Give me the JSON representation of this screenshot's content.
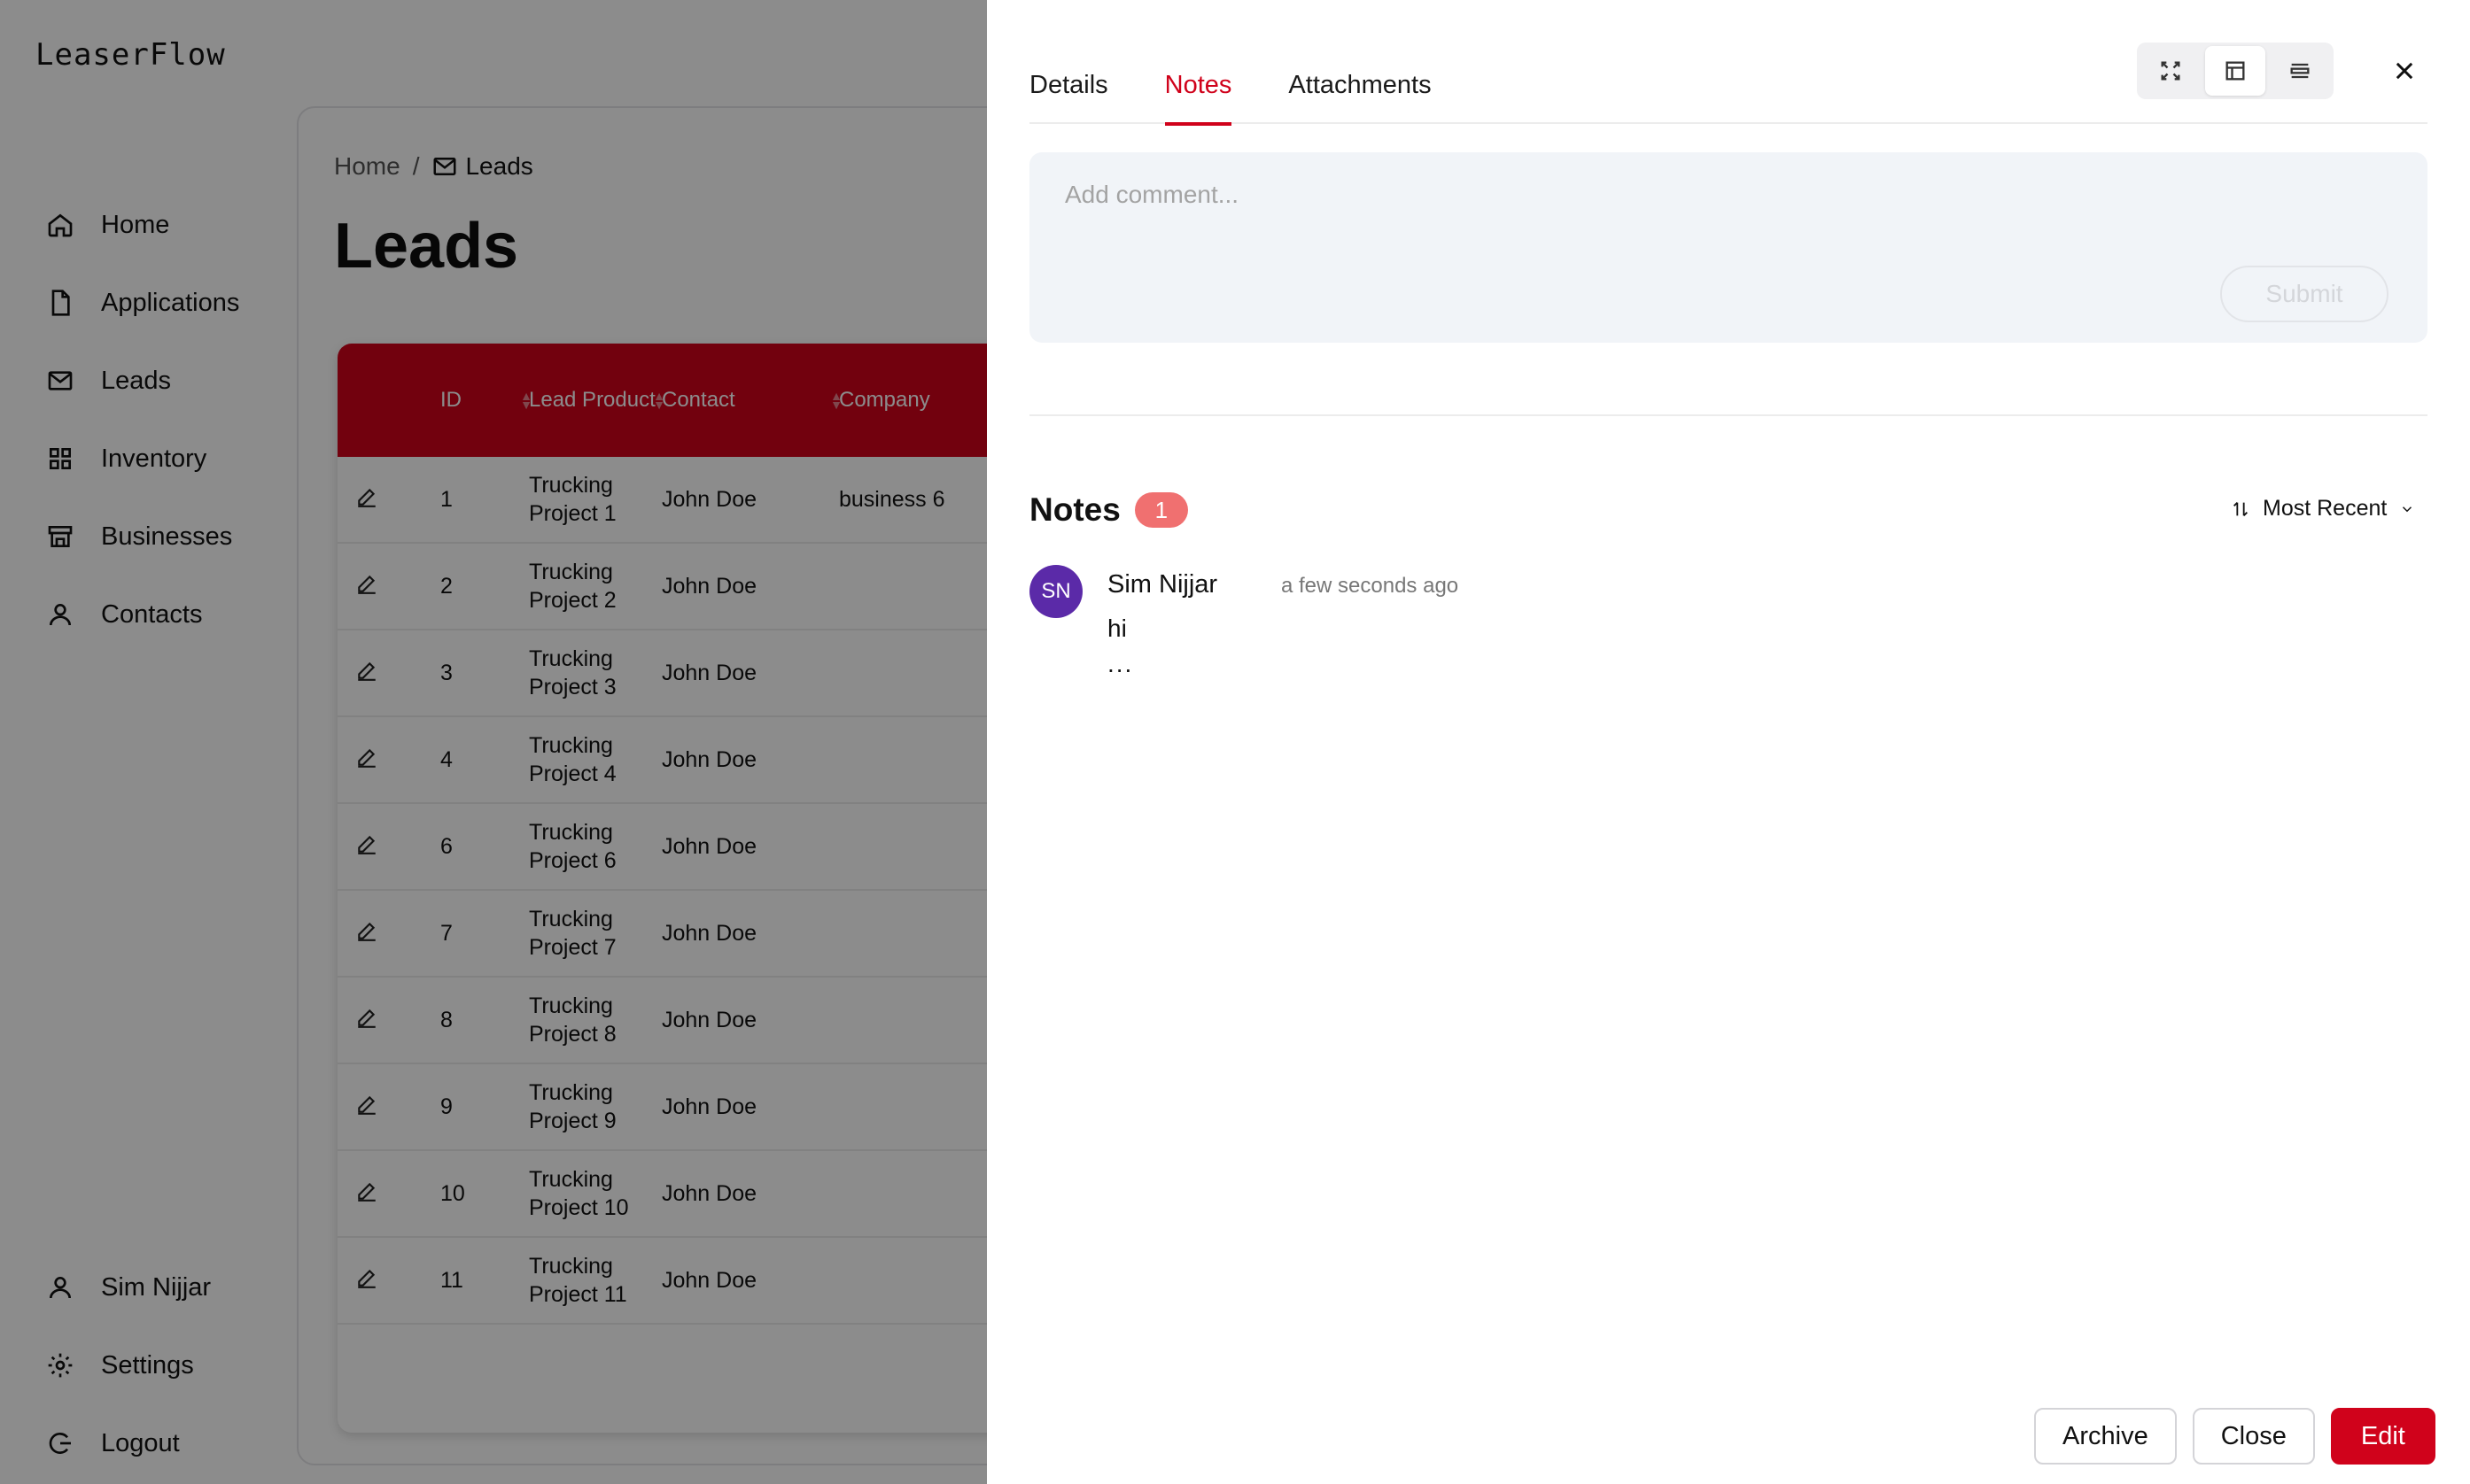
{
  "app": {
    "logo": "LeaserFlow",
    "nav": [
      {
        "label": "Home",
        "icon": "home-icon"
      },
      {
        "label": "Applications",
        "icon": "file-icon"
      },
      {
        "label": "Leads",
        "icon": "mail-icon"
      },
      {
        "label": "Inventory",
        "icon": "grid-icon"
      },
      {
        "label": "Businesses",
        "icon": "store-icon"
      },
      {
        "label": "Contacts",
        "icon": "user-icon"
      }
    ],
    "nav_bottom": [
      {
        "label": "Sim Nijjar",
        "icon": "user-icon"
      },
      {
        "label": "Settings",
        "icon": "gear-icon"
      },
      {
        "label": "Logout",
        "icon": "logout-icon"
      }
    ]
  },
  "leads_page": {
    "breadcrumb_home": "Home",
    "breadcrumb_sep": "/",
    "breadcrumb_current": "Leads",
    "title": "Leads",
    "columns": [
      "ID",
      "Lead Product",
      "Contact",
      "Company"
    ],
    "rows": [
      {
        "id": "1",
        "product": "Trucking Project 1",
        "contact": "John Doe",
        "company": "business 6"
      },
      {
        "id": "2",
        "product": "Trucking Project 2",
        "contact": "John Doe",
        "company": ""
      },
      {
        "id": "3",
        "product": "Trucking Project 3",
        "contact": "John Doe",
        "company": ""
      },
      {
        "id": "4",
        "product": "Trucking Project 4",
        "contact": "John Doe",
        "company": ""
      },
      {
        "id": "6",
        "product": "Trucking Project 6",
        "contact": "John Doe",
        "company": ""
      },
      {
        "id": "7",
        "product": "Trucking Project 7",
        "contact": "John Doe",
        "company": ""
      },
      {
        "id": "8",
        "product": "Trucking Project 8",
        "contact": "John Doe",
        "company": ""
      },
      {
        "id": "9",
        "product": "Trucking Project 9",
        "contact": "John Doe",
        "company": ""
      },
      {
        "id": "10",
        "product": "Trucking Project 10",
        "contact": "John Doe",
        "company": ""
      },
      {
        "id": "11",
        "product": "Trucking Project 11",
        "contact": "John Doe",
        "company": ""
      }
    ]
  },
  "drawer": {
    "tabs": [
      "Details",
      "Notes",
      "Attachments"
    ],
    "active_tab": "Notes",
    "comment_placeholder": "Add comment...",
    "submit_label": "Submit",
    "notes_title": "Notes",
    "notes_count": "1",
    "sort_label": "Most Recent",
    "notes": [
      {
        "initials": "SN",
        "author": "Sim Nijjar",
        "time": "a few seconds ago",
        "body": "hi",
        "more": "..."
      }
    ],
    "footer": {
      "archive": "Archive",
      "close": "Close",
      "edit": "Edit"
    }
  },
  "colors": {
    "brand": "#d0021b",
    "avatar": "#5b2aa8",
    "badge": "#f07070"
  }
}
